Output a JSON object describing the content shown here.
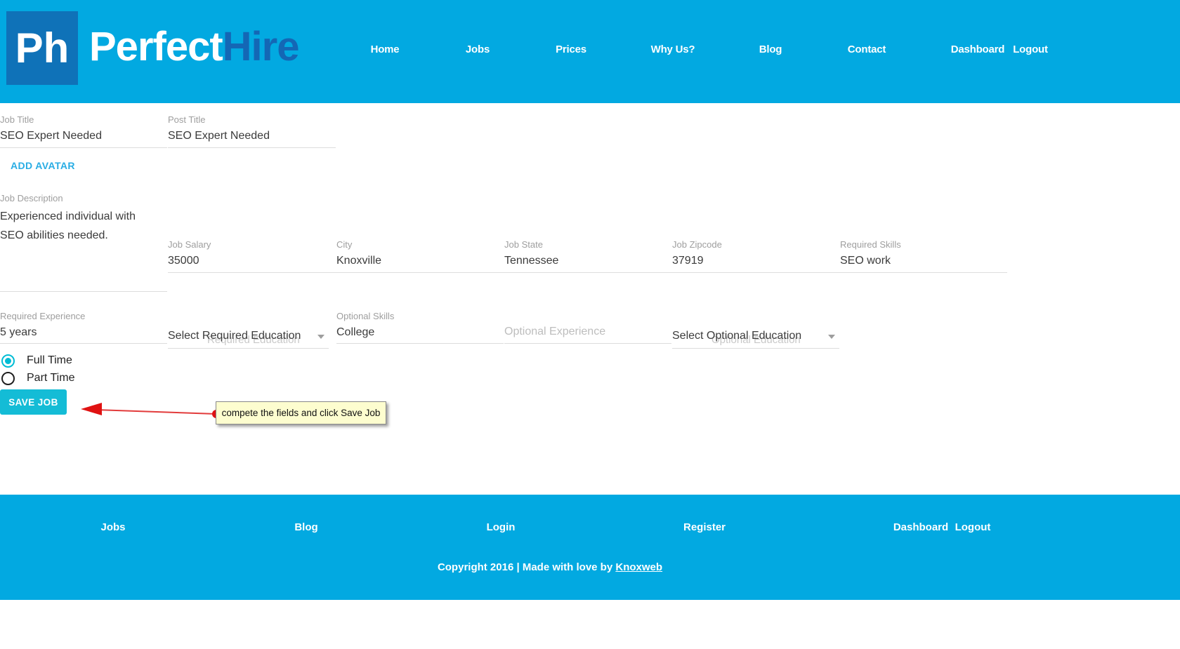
{
  "header": {
    "logo": {
      "badge": "Ph",
      "brand_primary": "Perfect",
      "brand_secondary": "Hire"
    },
    "nav": [
      "Home",
      "Jobs",
      "Prices",
      "Why Us?",
      "Blog",
      "Contact",
      "Dashboard",
      "Logout"
    ]
  },
  "form": {
    "job_title": {
      "label": "Job Title",
      "value": "SEO Expert Needed"
    },
    "post_title": {
      "label": "Post Title",
      "value": "SEO Expert Needed"
    },
    "add_avatar_label": "ADD AVATAR",
    "job_description": {
      "label": "Job Description",
      "value": "Experienced individual with SEO abilities needed."
    },
    "job_salary": {
      "label": "Job Salary",
      "value": "35000"
    },
    "city": {
      "label": "City",
      "value": "Knoxville"
    },
    "job_state": {
      "label": "Job State",
      "value": "Tennessee"
    },
    "job_zipcode": {
      "label": "Job Zipcode",
      "value": "37919"
    },
    "required_skills": {
      "label": "Required Skills",
      "value": "SEO work"
    },
    "required_experience": {
      "label": "Required Experience",
      "value": "5 years"
    },
    "required_education": {
      "value": "Select Required Education",
      "ghost": "Required Education"
    },
    "optional_skills": {
      "label": "Optional Skills",
      "value": "College"
    },
    "optional_experience": {
      "label": "",
      "placeholder": "Optional Experience"
    },
    "optional_education": {
      "value": "Select Optional Education",
      "ghost": "Optional Education"
    },
    "employment_type": {
      "options": [
        {
          "label": "Full Time",
          "selected": true
        },
        {
          "label": "Part Time",
          "selected": false
        }
      ]
    },
    "save_button": "SAVE JOB"
  },
  "annotation": {
    "text": "compete the fields and click Save Job"
  },
  "footer": {
    "links": [
      "Jobs",
      "Blog",
      "Login",
      "Register",
      "Dashboard",
      "Logout"
    ],
    "copyright_prefix": "Copyright 2016 | Made with love by ",
    "copyright_link": "Knoxweb"
  },
  "colors": {
    "header_footer_blue": "#02A9E1",
    "logo_square_blue": "#0F72B8",
    "brand_secondary_blue": "#1467B5",
    "button_cyan": "#14BCD6",
    "link_cyan": "#29ADE4",
    "radio_selected_cyan": "#00BCD4",
    "annotation_red": "#E01212",
    "tooltip_yellow": "#FDFDCF",
    "label_gray": "#9E9E9E",
    "underline_gray": "#DDDDDD"
  }
}
